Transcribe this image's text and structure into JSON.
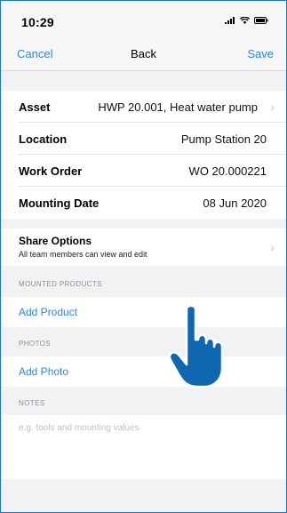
{
  "status_bar": {
    "time": "10:29"
  },
  "nav": {
    "cancel": "Cancel",
    "title": "Back",
    "save": "Save"
  },
  "fields": [
    {
      "label": "Asset",
      "value": "HWP 20.001, Heat water pump"
    },
    {
      "label": "Location",
      "value": "Pump Station 20"
    },
    {
      "label": "Work Order",
      "value": "WO 20.000221"
    },
    {
      "label": "Mounting Date",
      "value": "08 Jun 2020"
    }
  ],
  "share": {
    "title": "Share Options",
    "subtitle": "All team members can view and edit"
  },
  "sections": {
    "mounted_products": {
      "header": "MOUNTED PRODUCTS",
      "action": "Add Product"
    },
    "photos": {
      "header": "PHOTOS",
      "action": "Add Photo"
    },
    "notes": {
      "header": "NOTES",
      "placeholder": "e.g. tools and mounting values"
    }
  },
  "colors": {
    "accent": "#2f86d6",
    "pointer": "#0f67b1",
    "border": "#1f77c2"
  },
  "icons": [
    "signal-icon",
    "wifi-icon",
    "battery-icon",
    "chevron-right-icon",
    "pointing-hand-icon"
  ]
}
